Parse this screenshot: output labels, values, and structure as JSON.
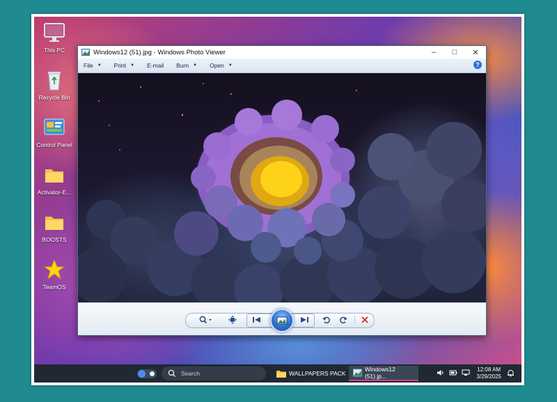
{
  "desktop_icons": [
    {
      "label": "This PC",
      "icon": "monitor-icon"
    },
    {
      "label": "Recycle Bin",
      "icon": "recycle-bin-icon"
    },
    {
      "label": "Control Panel",
      "icon": "control-panel-icon"
    },
    {
      "label": "Activator-E...",
      "icon": "folder-icon"
    },
    {
      "label": "BOOSTS",
      "icon": "folder-icon"
    },
    {
      "label": "TeamOS",
      "icon": "star-icon"
    }
  ],
  "window": {
    "title": "Windows12 (51).jpg - Windows Photo Viewer",
    "menu": [
      {
        "label": "File",
        "has_arrow": true
      },
      {
        "label": "Print",
        "has_arrow": true
      },
      {
        "label": "E-mail",
        "has_arrow": false
      },
      {
        "label": "Burn",
        "has_arrow": true
      },
      {
        "label": "Open",
        "has_arrow": true
      }
    ],
    "help_label": "?"
  },
  "taskbar": {
    "search_placeholder": "Search",
    "apps": [
      {
        "label": "WALLPAPERS PACK",
        "icon": "folder-icon",
        "active": false
      },
      {
        "label": "Windows12 (51).jp...",
        "icon": "photo-icon",
        "active": true
      }
    ],
    "time": "12:08 AM",
    "date": "3/29/2025"
  },
  "colors": {
    "accent": "#2f6fd1",
    "taskbar": "#202833",
    "active_indicator": "#d23a8f",
    "folder": "#f5c14a"
  }
}
